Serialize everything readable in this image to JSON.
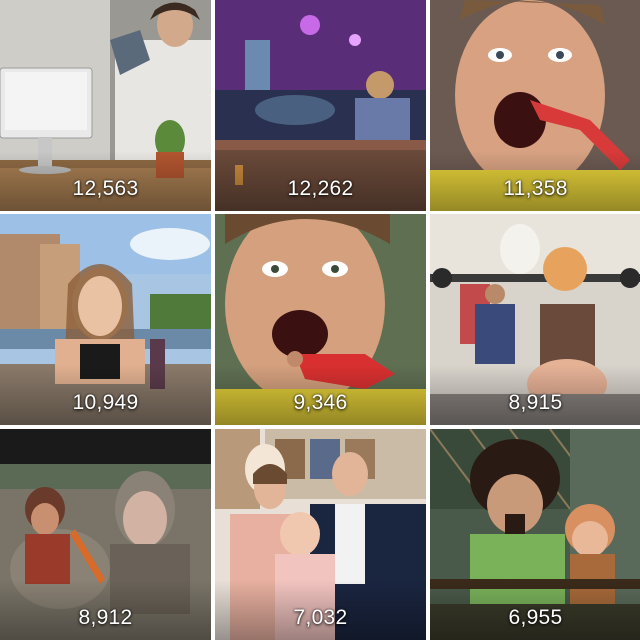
{
  "grid": {
    "tiles": [
      {
        "count": "12,563"
      },
      {
        "count": "12,262"
      },
      {
        "count": "11,358"
      },
      {
        "count": "10,949"
      },
      {
        "count": "9,346"
      },
      {
        "count": "8,915"
      },
      {
        "count": "8,912"
      },
      {
        "count": "7,032"
      },
      {
        "count": "6,955"
      }
    ]
  }
}
